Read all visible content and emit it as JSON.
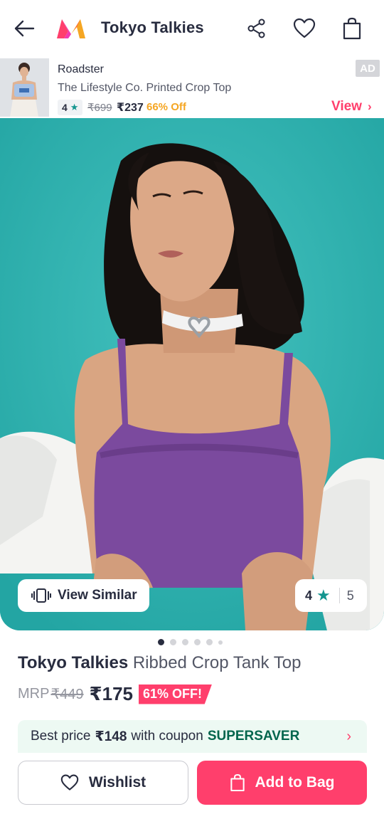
{
  "header": {
    "title": "Tokyo Talkies",
    "icons": [
      "back-arrow-icon",
      "myntra-logo",
      "share-icon",
      "heart-icon",
      "bag-icon"
    ]
  },
  "ad": {
    "tag": "AD",
    "brand": "Roadster",
    "name": "The Lifestyle Co. Printed Crop Top",
    "rating": "4",
    "mrp": "₹699",
    "price": "₹237",
    "discount": "66% Off",
    "view_label": "View",
    "view_chevron": "›"
  },
  "hero": {
    "view_similar_label": "View Similar",
    "rating": "4",
    "rating_count": "5",
    "carousel": {
      "total_slides": 6,
      "active_index": 0
    }
  },
  "product": {
    "brand": "Tokyo Talkies",
    "name": "Ribbed Crop Tank Top",
    "mrp_label": "MRP",
    "mrp": "₹449",
    "price": "₹175",
    "discount": "61% OFF!"
  },
  "coupon": {
    "prefix": "Best price",
    "best_price": "₹148",
    "middle": "with coupon",
    "code": "SUPERSAVER",
    "chevron": "›"
  },
  "actions": {
    "wishlist_label": "Wishlist",
    "add_to_bag_label": "Add to Bag"
  },
  "colors": {
    "accent": "#ff3f6c",
    "rating_star": "#14958f",
    "discount_orange": "#f5a623",
    "hero_background": "#2fb3b1",
    "coupon_bg": "#edf9f3",
    "top_purple": "#7b4a9e"
  }
}
